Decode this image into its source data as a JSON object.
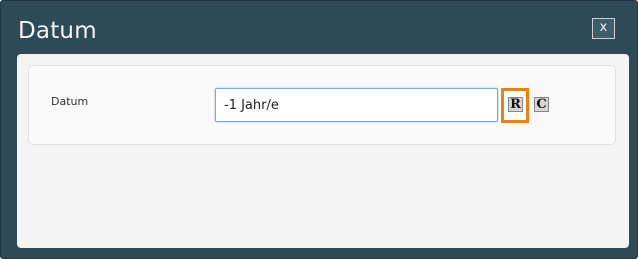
{
  "dialog": {
    "title": "Datum",
    "close_label": "x"
  },
  "form": {
    "date_label": "Datum",
    "date_value": "-1 Jahr/e"
  },
  "icons": {
    "relative_button": {
      "glyph": "R",
      "name": "relative-date-icon",
      "highlight_color": "#f07f12"
    },
    "calendar_button": {
      "glyph": "C",
      "name": "calendar-icon"
    }
  },
  "colors": {
    "titlebar": "#2e4a57",
    "body": "#f4f4f4",
    "input_focus_border": "#79a8d6"
  }
}
